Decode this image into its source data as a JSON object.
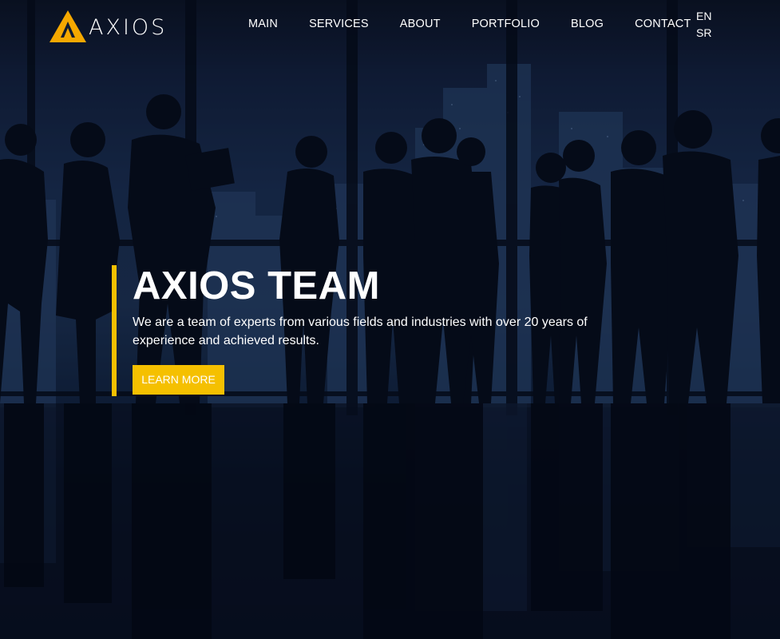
{
  "brand": {
    "name": "AXIOS",
    "accent_color": "#f5c000",
    "logo_icon": "triangle-a-logo-icon"
  },
  "nav": {
    "items": [
      {
        "label": "MAIN"
      },
      {
        "label": "SERVICES"
      },
      {
        "label": "ABOUT"
      },
      {
        "label": "PORTFOLIO"
      },
      {
        "label": "BLOG"
      },
      {
        "label": "CONTACT"
      }
    ]
  },
  "language": {
    "options": [
      {
        "label": "EN"
      },
      {
        "label": "SR"
      }
    ]
  },
  "hero": {
    "title": "AXIOS TEAM",
    "text": "We are a team of experts from various fields and industries with over 20 years of experience and achieved results.",
    "button_label": "LEARN MORE"
  }
}
